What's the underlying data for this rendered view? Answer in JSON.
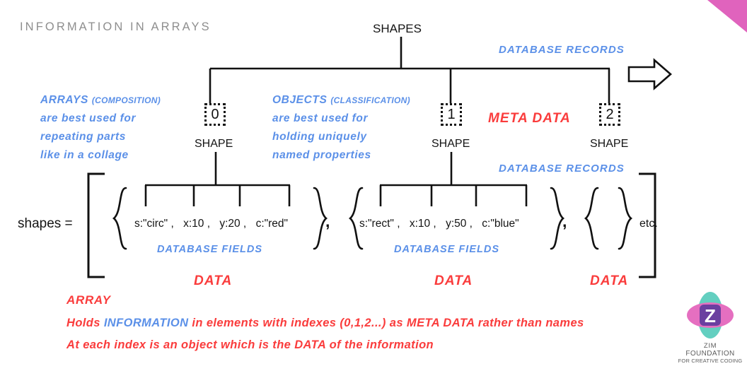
{
  "meta": {
    "title": "INFORMATION IN ARRAYS",
    "colors": {
      "blue": "#5b90e8",
      "red": "#fa3c3c",
      "pink_corner": "#e063bd",
      "title_gray": "#8e8e8e",
      "line_black": "#111111"
    }
  },
  "tree": {
    "root_label": "SHAPES",
    "nodes": [
      {
        "index": "0",
        "label": "SHAPE"
      },
      {
        "index": "1",
        "label": "SHAPE"
      },
      {
        "index": "2",
        "label": "SHAPE"
      }
    ],
    "meta_data_label": "META DATA",
    "records_label_top": "DATABASE RECORDS",
    "records_label_mid": "DATABASE RECORDS",
    "arrow": "right-arrow"
  },
  "callouts": {
    "arrays": {
      "heading": "ARRAYS",
      "heading_note": "(COMPOSITION)",
      "lines": [
        "are best used for",
        "repeating parts",
        "like in a collage"
      ]
    },
    "objects": {
      "heading": "OBJECTS",
      "heading_note": "(CLASSIFICATION)",
      "lines": [
        "are best used for",
        "holding uniquely",
        "named properties"
      ]
    }
  },
  "expression": {
    "variable": "shapes =",
    "etc": "etc.",
    "separator": ",",
    "objects": [
      {
        "fields": [
          "s:\"circ\" ,",
          "x:10 ,",
          "y:20 ,",
          "c:\"red\""
        ],
        "fields_label": "DATABASE FIELDS",
        "data_label": "DATA"
      },
      {
        "fields": [
          "s:\"rect\" ,",
          "x:10 ,",
          "y:50 ,",
          "c:\"blue\""
        ],
        "fields_label": "DATABASE FIELDS",
        "data_label": "DATA"
      },
      {
        "fields": [],
        "fields_label": "",
        "data_label": "DATA"
      }
    ]
  },
  "notes": {
    "array_heading": "ARRAY",
    "line1_part1": "Holds ",
    "line1_highlight": "INFORMATION",
    "line1_part2": " in elements with indexes (0,1,2...) as META DATA rather than names",
    "line2": "At each index is an object which is the DATA of the information"
  },
  "logo": {
    "mark": "Z",
    "line1": "ZIM",
    "line2": "FOUNDATION",
    "line3": "FOR CREATIVE CODING"
  }
}
